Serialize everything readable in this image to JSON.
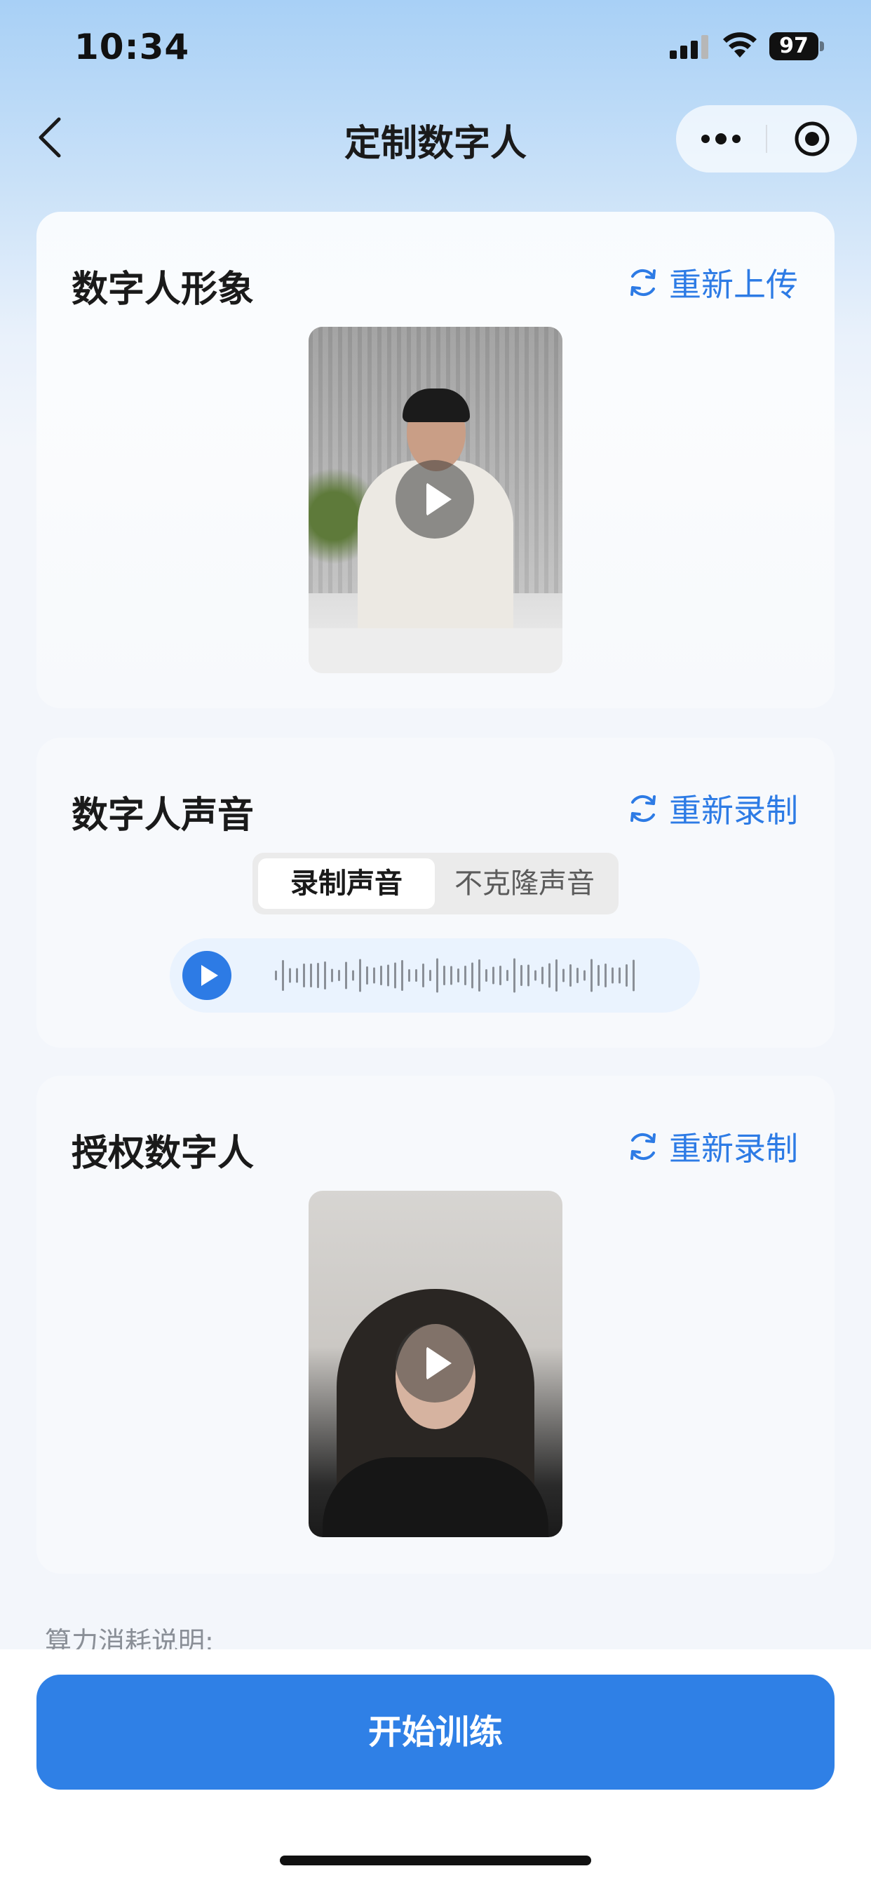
{
  "status_bar": {
    "time": "10:34",
    "battery": "97",
    "icons": [
      "signal-icon",
      "wifi-icon",
      "battery-icon"
    ]
  },
  "nav": {
    "title": "定制数字人",
    "back_icon": "chevron-left-icon",
    "more_icon": "more-dots-icon",
    "close_icon": "target-circle-icon"
  },
  "sections": {
    "avatar": {
      "title": "数字人形象",
      "action_label": "重新上传",
      "action_icon": "refresh-icon"
    },
    "voice": {
      "title": "数字人声音",
      "action_label": "重新录制",
      "action_icon": "refresh-icon",
      "tabs": [
        "录制声音",
        "不克隆声音"
      ],
      "selected_tab": "录制声音"
    },
    "authorize": {
      "title": "授权数字人",
      "action_label": "重新录制",
      "action_icon": "refresh-icon"
    }
  },
  "footer": {
    "compute_note": "算力消耗说明:",
    "start_button": "开始训练"
  },
  "colors": {
    "accent": "#2f80e6",
    "link": "#2d7be5",
    "background": "#f3f6fb"
  }
}
